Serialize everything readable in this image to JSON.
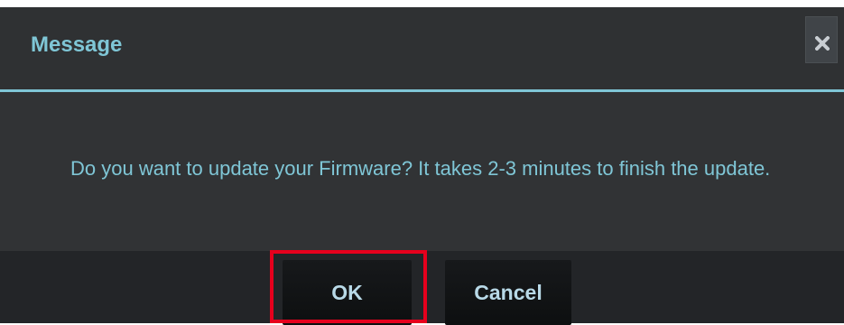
{
  "dialog": {
    "title": "Message",
    "close_icon": "close-icon",
    "message": "Do you want to update your Firmware? It takes 2-3 minutes to finish the update.",
    "buttons": {
      "ok_label": "OK",
      "cancel_label": "Cancel"
    }
  },
  "colors": {
    "dialog_background": "#313335",
    "footer_background": "#232528",
    "accent": "#7fc6d6",
    "button_background": "#111315",
    "highlight": "#e6001d"
  }
}
